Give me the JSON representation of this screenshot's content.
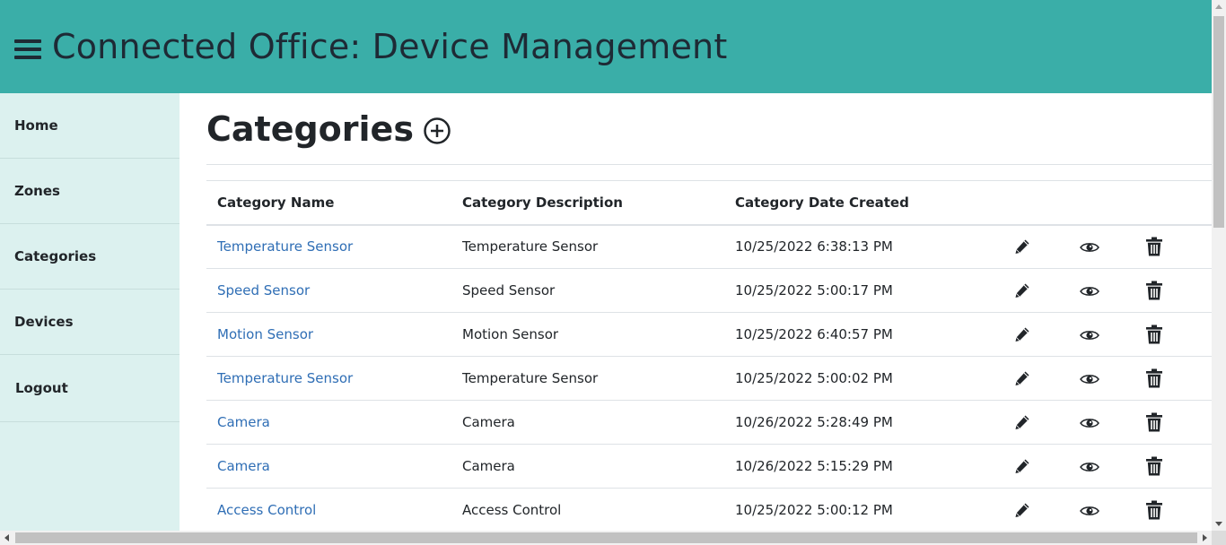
{
  "app": {
    "title": "Connected Office: Device Management"
  },
  "sidebar": {
    "items": [
      {
        "label": "Home"
      },
      {
        "label": "Zones"
      },
      {
        "label": "Categories"
      },
      {
        "label": "Devices"
      },
      {
        "label": "Logout"
      }
    ]
  },
  "page": {
    "title": "Categories"
  },
  "table": {
    "columns": [
      "Category Name",
      "Category Description",
      "Category Date Created"
    ],
    "rows": [
      {
        "name": "Temperature Sensor",
        "description": "Temperature Sensor",
        "created": "10/25/2022 6:38:13 PM"
      },
      {
        "name": "Speed Sensor",
        "description": "Speed Sensor",
        "created": "10/25/2022 5:00:17 PM"
      },
      {
        "name": "Motion Sensor",
        "description": "Motion Sensor",
        "created": "10/25/2022 6:40:57 PM"
      },
      {
        "name": "Temperature Sensor",
        "description": "Temperature Sensor",
        "created": "10/25/2022 5:00:02 PM"
      },
      {
        "name": "Camera",
        "description": "Camera",
        "created": "10/26/2022 5:28:49 PM"
      },
      {
        "name": "Camera",
        "description": "Camera",
        "created": "10/26/2022 5:15:29 PM"
      },
      {
        "name": "Access Control",
        "description": "Access Control",
        "created": "10/25/2022 5:00:12 PM"
      }
    ],
    "row_actions": [
      "pencil-icon",
      "eye-icon",
      "trash-icon"
    ]
  },
  "icons": {
    "menu": "hamburger-icon",
    "add": "plus-circle-icon"
  },
  "colors": {
    "header_bg": "#3aaea8",
    "sidebar_bg": "#dcf1ef",
    "link": "#2f6eb5",
    "title": "#1e2a35"
  }
}
